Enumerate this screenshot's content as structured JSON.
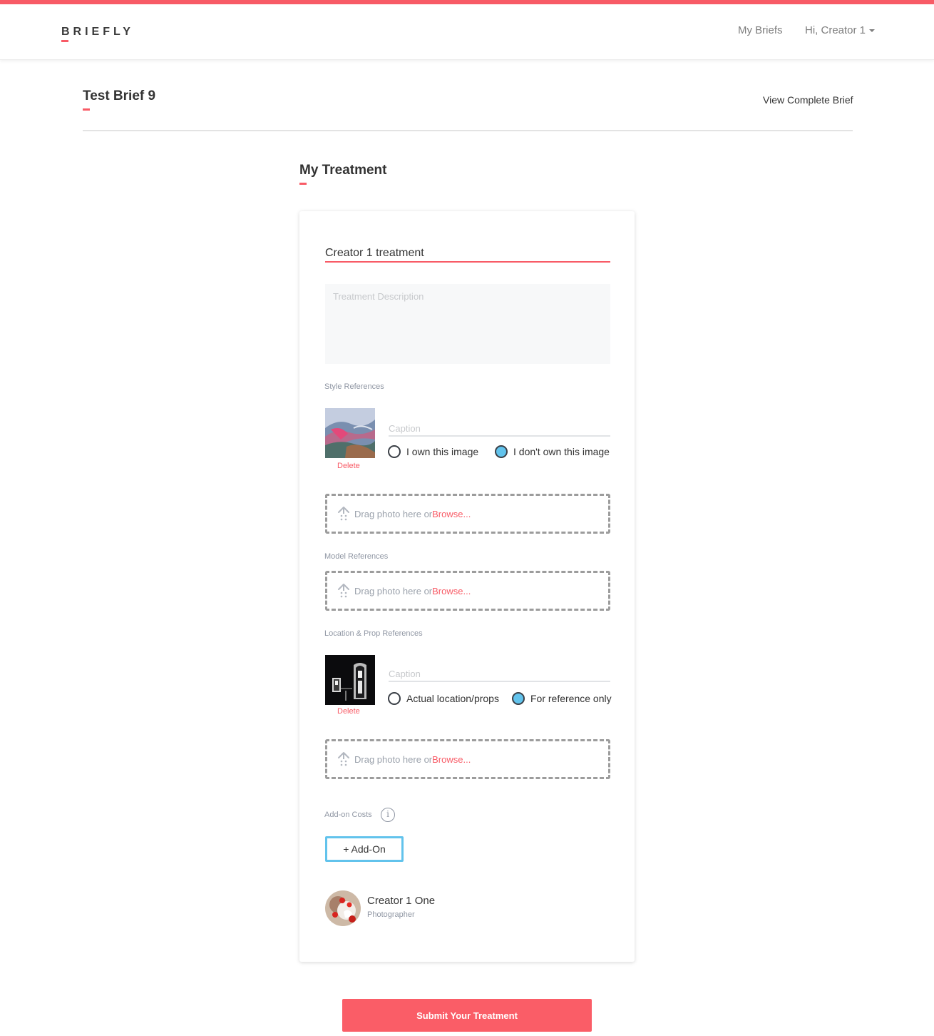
{
  "header": {
    "logo": "BRIEFLY",
    "nav_my_briefs": "My Briefs",
    "nav_user": "Hi, Creator 1",
    "accent_color": "#f85b66"
  },
  "brief": {
    "title": "Test Brief 9",
    "view_link": "View Complete Brief"
  },
  "treatment": {
    "section_title": "My Treatment",
    "title_value": "Creator 1 treatment",
    "description_placeholder": "Treatment Description",
    "style_references": {
      "label": "Style References",
      "image": {
        "caption_placeholder": "Caption",
        "delete_label": "Delete",
        "options": [
          {
            "label": "I own this image",
            "checked": false
          },
          {
            "label": "I don't own this image",
            "checked": true
          }
        ]
      },
      "dropzone": {
        "text": "Drag photo here or ",
        "browse": "Browse..."
      }
    },
    "model_references": {
      "label": "Model References",
      "dropzone": {
        "text": "Drag photo here or ",
        "browse": "Browse..."
      }
    },
    "location_references": {
      "label": "Location & Prop References",
      "image": {
        "caption_placeholder": "Caption",
        "delete_label": "Delete",
        "options": [
          {
            "label": "Actual location/props",
            "checked": false
          },
          {
            "label": "For reference only",
            "checked": true
          }
        ]
      },
      "dropzone": {
        "text": "Drag photo here or ",
        "browse": "Browse..."
      }
    },
    "addon": {
      "label": "Add-on Costs",
      "info_icon": "i",
      "button": "+ Add-On",
      "button_color": "#62c3ec"
    },
    "creator": {
      "name": "Creator 1 One",
      "role": "Photographer"
    }
  },
  "submit_label": "Submit Your Treatment"
}
